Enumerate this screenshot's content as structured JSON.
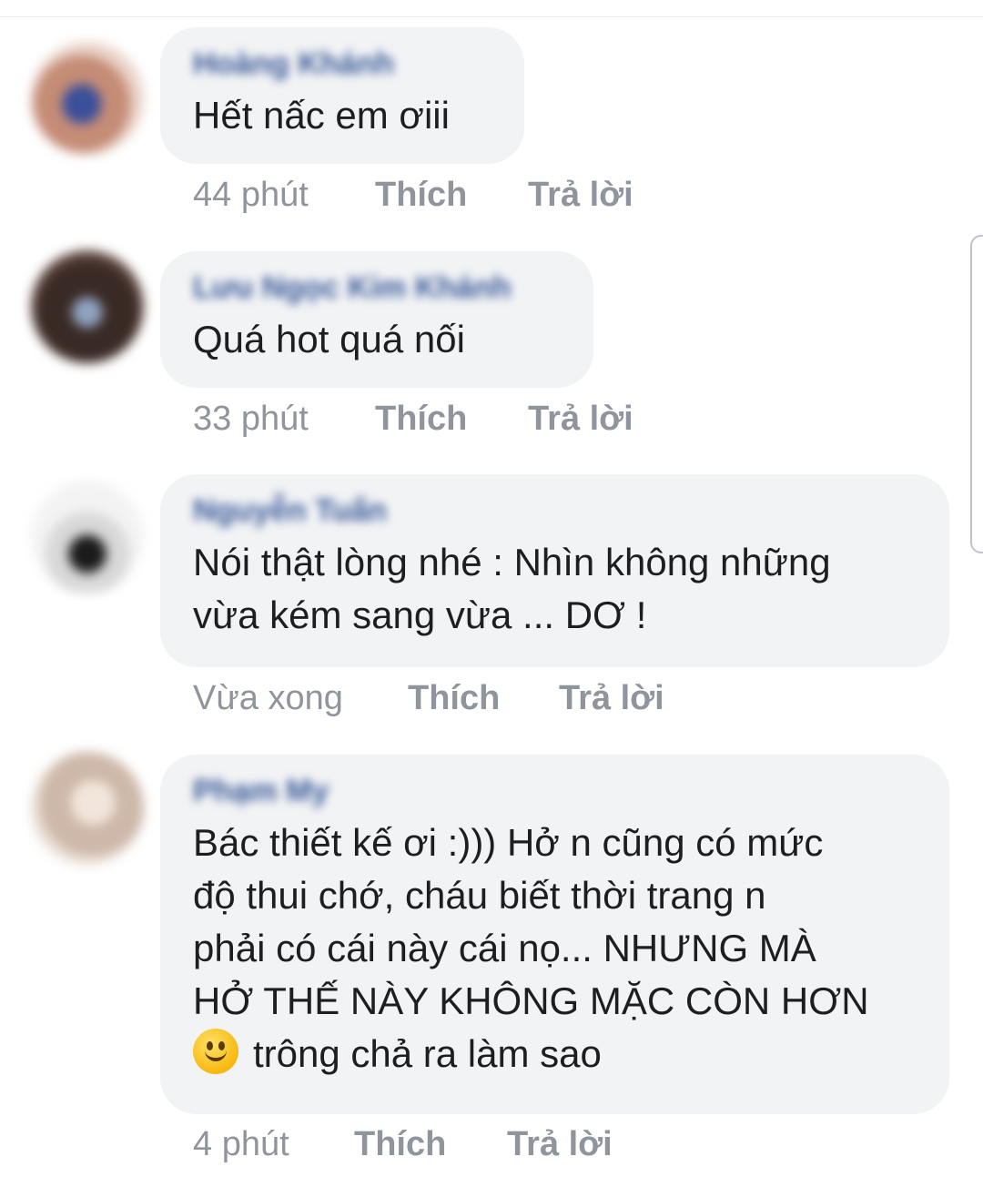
{
  "comments": [
    {
      "author": "Hoàng Khánh",
      "text": "Hết nấc em ơiii",
      "time": "44 phút",
      "like_label": "Thích",
      "reply_label": "Trả lời"
    },
    {
      "author": "Lưu Ngọc Kim Khánh",
      "text": "Quá hot quá nối",
      "time": "33 phút",
      "like_label": "Thích",
      "reply_label": "Trả lời"
    },
    {
      "author": "Nguyễn Tuấn",
      "text": "Nói thật lòng nhé : Nhìn không những\nvừa kém sang vừa ... DƠ !",
      "time": "Vừa xong",
      "like_label": "Thích",
      "reply_label": "Trả lời"
    },
    {
      "author": "Phạm My",
      "text": "Bác thiết kế ơi :))) Hở n cũng có mức\nđộ thui chớ, cháu biết thời trang n\nphải có cái này cái nọ... NHƯNG MÀ\nHỞ THẾ NÀY KHÔNG MẶC CÒN HƠN",
      "text_last": "trông chả ra làm sao",
      "emoji": "smiling-face-emoji",
      "time": "4 phút",
      "like_label": "Thích",
      "reply_label": "Trả lời"
    }
  ],
  "colors": {
    "bubble": "#f2f3f5",
    "text": "#1c1e21",
    "meta": "#90949c"
  }
}
